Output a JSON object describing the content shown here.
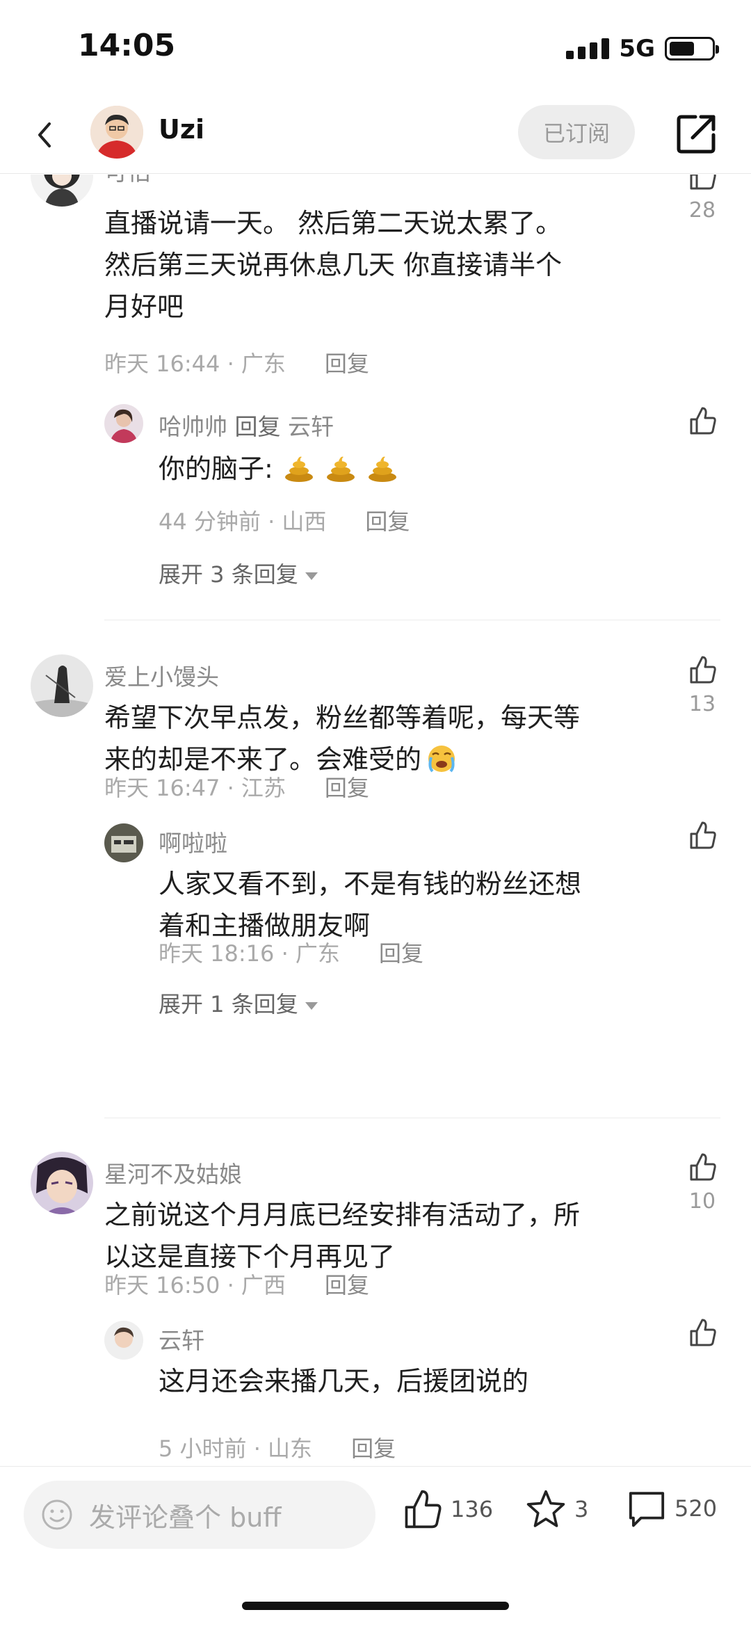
{
  "status_bar": {
    "time": "14:05",
    "network": "5G",
    "battery_level": 0.6
  },
  "header": {
    "title": "Uzi",
    "subscribe_label": "已订阅"
  },
  "comments": [
    {
      "name": "可怕",
      "text_lines": [
        "直播说请一天。 然后第二天说太累了。",
        "然后第三天说再休息几天   你直接请半个",
        "月好吧"
      ],
      "time": "昨天 16:44 · 广东",
      "reply_label": "回复",
      "likes": "28",
      "replies": [
        {
          "name": "哈帅帅",
          "reply_word": "回复",
          "reply_to": "云轩",
          "text": "你的脑子:",
          "emoji": [
            "poop",
            "poop",
            "poop"
          ],
          "time": "44 分钟前 · 山西",
          "reply_label": "回复"
        }
      ],
      "expand_label": "展开 3 条回复"
    },
    {
      "name": "爱上小馒头",
      "text_lines": [
        "希望下次早点发，粉丝都等着呢，每天等",
        "来的却是不来了。会难受的"
      ],
      "time": "昨天 16:47 · 江苏",
      "reply_label": "回复",
      "likes": "13",
      "replies": [
        {
          "name": "啊啦啦",
          "text_lines": [
            "人家又看不到，不是有钱的粉丝还想",
            "着和主播做朋友啊"
          ],
          "time": "昨天 18:16 · 广东",
          "reply_label": "回复"
        }
      ],
      "expand_label": "展开 1 条回复"
    },
    {
      "name": "星河不及姑娘",
      "text_lines": [
        "之前说这个月月底已经安排有活动了，所",
        "以这是直接下个月再见了"
      ],
      "time": "昨天 16:50 · 广西",
      "reply_label": "回复",
      "likes": "10",
      "replies": [
        {
          "name": "云轩",
          "text": "这月还会来播几天，后援团说的",
          "time": "5 小时前 · 山东",
          "reply_label": "回复"
        }
      ]
    }
  ],
  "bottom_bar": {
    "placeholder": "发评论叠个 buff",
    "likes": "136",
    "stars": "3",
    "comments": "520"
  }
}
